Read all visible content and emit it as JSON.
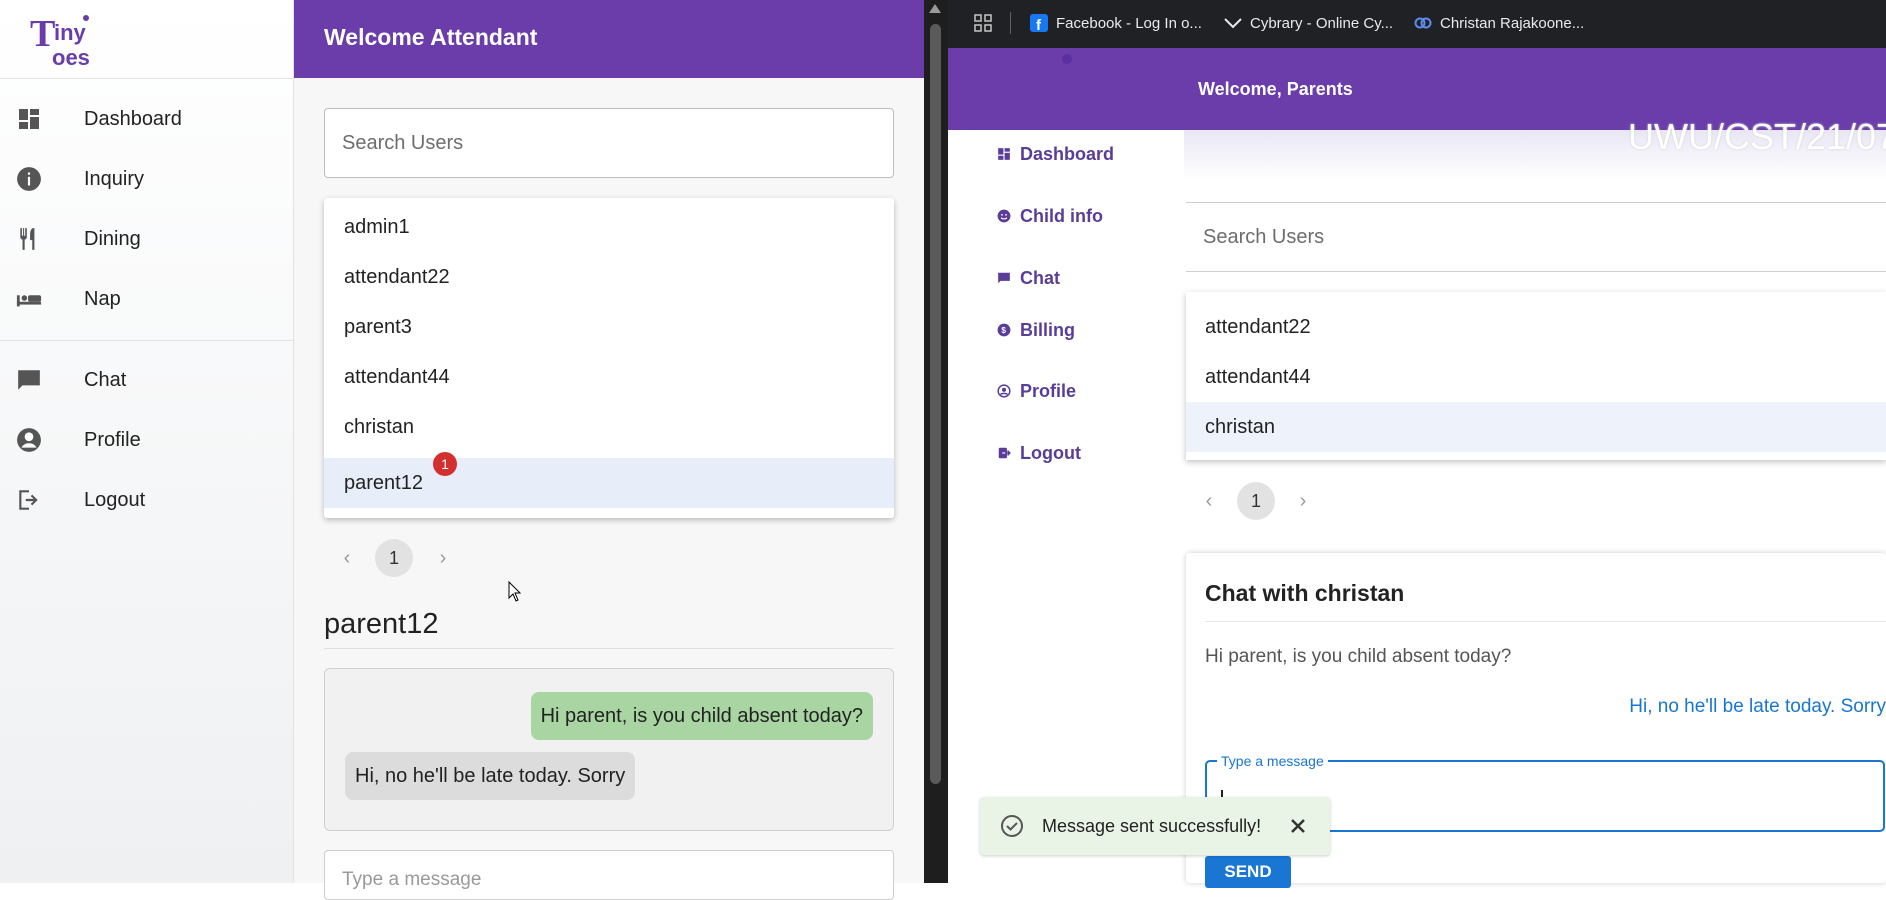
{
  "left_app": {
    "logo_text": "Tiny Toes",
    "sidebar": {
      "items": [
        {
          "label": "Dashboard",
          "icon": "dashboard-icon"
        },
        {
          "label": "Inquiry",
          "icon": "info-icon"
        },
        {
          "label": "Dining",
          "icon": "restaurant-icon"
        },
        {
          "label": "Nap",
          "icon": "bed-icon"
        },
        {
          "label": "Chat",
          "icon": "chat-icon"
        },
        {
          "label": "Profile",
          "icon": "account-icon"
        },
        {
          "label": "Logout",
          "icon": "logout-icon"
        }
      ]
    },
    "header": {
      "title": "Welcome Attendant"
    },
    "search": {
      "placeholder": "Search Users"
    },
    "users": [
      "admin1",
      "attendant22",
      "parent3",
      "attendant44",
      "christan",
      "parent12"
    ],
    "selected_user": "parent12",
    "unread_badge": "1",
    "pagination": {
      "page": "1"
    },
    "chat": {
      "title": "parent12",
      "messages": [
        {
          "from": "me",
          "text": "Hi parent, is you child absent today?"
        },
        {
          "from": "them",
          "text": "Hi, no he'll be late today. Sorry"
        }
      ],
      "input_placeholder": "Type a message"
    }
  },
  "browser": {
    "bookmarks": [
      {
        "label": "Facebook - Log In o...",
        "icon": "facebook-icon"
      },
      {
        "label": "Cybrary - Online Cy...",
        "icon": "cybrary-icon"
      },
      {
        "label": "Christan Rajakoone...",
        "icon": "link-icon"
      }
    ]
  },
  "right_app": {
    "header": {
      "title": "Welcome, Parents"
    },
    "watermark": "UWU/CST/21/07",
    "sidebar": {
      "items": [
        {
          "label": "Dashboard",
          "icon": "dashboard-icon"
        },
        {
          "label": "Child info",
          "icon": "child-icon"
        },
        {
          "label": "Chat",
          "icon": "chat-icon"
        },
        {
          "label": "Billing",
          "icon": "billing-icon"
        },
        {
          "label": "Profile",
          "icon": "account-icon"
        },
        {
          "label": "Logout",
          "icon": "logout-icon"
        }
      ]
    },
    "search": {
      "placeholder": "Search Users"
    },
    "users": [
      "attendant22",
      "attendant44",
      "christan"
    ],
    "selected_user": "christan",
    "pagination": {
      "page": "1"
    },
    "chat": {
      "title": "Chat with christan",
      "messages": [
        {
          "from": "them",
          "text": "Hi parent, is you child absent today?"
        },
        {
          "from": "me",
          "text": "Hi, no he'll be late today. Sorry"
        }
      ],
      "input_label": "Type a message",
      "send_label": "SEND"
    },
    "toast": {
      "message": "Message sent successfully!"
    }
  },
  "colors": {
    "brand_purple": "#6a3dab",
    "sent_bubble": "#a8d5a2",
    "received_bubble": "#dcdcdc",
    "badge_red": "#d32f2f",
    "accent_blue": "#1976d2",
    "toast_bg": "#e9f3e6"
  }
}
